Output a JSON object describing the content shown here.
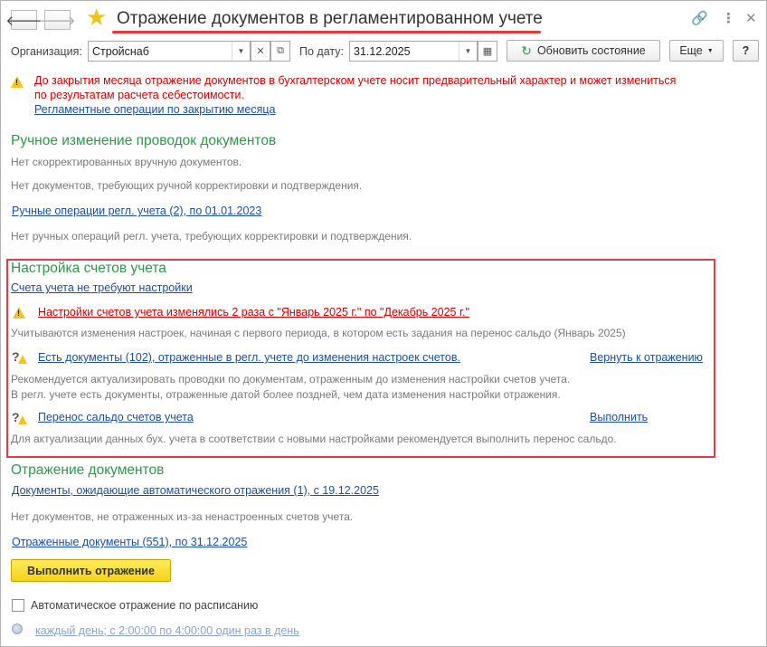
{
  "header": {
    "title": "Отражение документов в регламентированном учете",
    "icons": [
      "back-icon",
      "forward-icon",
      "favorite-star-icon",
      "link-icon",
      "more-icon",
      "close-icon"
    ]
  },
  "toolbar": {
    "org_label": "Организация:",
    "org_value": "Стройснаб",
    "date_label": "По дату:",
    "date_value": "31.12.2025",
    "refresh_label": "Обновить состояние",
    "more_label": "Еще",
    "help_label": "?"
  },
  "notice": {
    "line1": "До закрытия месяца отражение документов в бухгалтерском учете носит предварительный характер и может измениться",
    "line2": "по результатам расчета себестоимости.",
    "link": "Регламентные операции по закрытию месяца"
  },
  "manual": {
    "heading": "Ручное изменение проводок документов",
    "text1": "Нет скорректированных вручную документов.",
    "text2": "Нет документов, требующих ручной корректировки и подтверждения.",
    "link": "Ручные операции регл. учета (2), по 01.01.2023",
    "text3": "Нет ручных операций регл. учета, требующих корректировки и подтверждения."
  },
  "accounts": {
    "heading": "Настройка счетов учета",
    "link_no_setup": "Счета учета не требуют настройки",
    "warning_link": "Настройки счетов учета изменялись 2 раза с \"Январь 2025 г.\" по \"Декабрь 2025 г.\"",
    "warning_note": "Учитываются изменения настроек, начиная с первого периода, в котором есть задания на перенос сальдо (Январь 2025)",
    "docs_link": "Есть документы (102), отраженные в регл. учете до изменения настроек счетов.",
    "docs_action": "Вернуть к отражению",
    "docs_note1": "Рекомендуется актуализировать проводки по документам, отраженным до изменения настройки счетов учета.",
    "docs_note2": "В регл. учете есть документы, отраженные датой более поздней, чем дата изменения настройки отражения.",
    "transfer_link": "Перенос сальдо счетов учета",
    "transfer_action": "Выполнить",
    "transfer_note": "Для актуализации данных бух. учета в соответствии с новыми настройками рекомендуется выполнить перенос сальдо."
  },
  "docs": {
    "heading": "Отражение документов",
    "pending_link": "Документы, ожидающие автоматического отражения (1), с 19.12.2025",
    "text1": "Нет документов, не отраженных из-за ненастроенных счетов учета.",
    "reflected_link": "Отраженные документы (551), по 31.12.2025",
    "run_button": "Выполнить отражение",
    "auto_checkbox_label": "Автоматическое отражение по расписанию",
    "auto_checked": false,
    "schedule_link": "каждый день; с 2:00:00 по 4:00:00 один раз в день"
  },
  "colors": {
    "heading_green": "#2d9a4b",
    "link_blue": "#1c4fa0",
    "warning_red": "#d40000",
    "highlight_box": "#e53a4a",
    "button_yellow": "#f5d21a"
  }
}
